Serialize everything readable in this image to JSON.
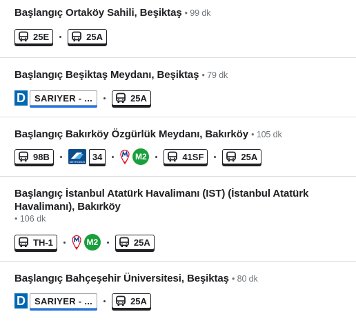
{
  "routes": [
    {
      "prefix": "Başlangıç",
      "place": "Ortaköy Sahili, Beşiktaş",
      "duration": "99 dk",
      "legs": [
        "25E",
        "25A"
      ]
    },
    {
      "prefix": "Başlangıç",
      "place": "Beşiktaş Meydanı, Beşiktaş",
      "duration": "79 dk",
      "ferry_icon": "D",
      "ferry_label": "SARIYER - ...",
      "legs": [
        "25A"
      ]
    },
    {
      "prefix": "Başlangıç",
      "place": "Bakırköy Özgürlük Meydanı, Bakırköy",
      "duration": "105 dk",
      "legs": [
        "98B",
        "34",
        "M2",
        "41SF",
        "25A"
      ],
      "metrobus_text": "METROBÜS"
    },
    {
      "prefix": "Başlangıç",
      "place_line1": "İstanbul Atatürk Havalimanı (IST) (İstanbul Atatürk",
      "place_line2": "Havalimanı), Bakırköy",
      "duration": "106 dk",
      "legs": [
        "TH-1",
        "M2",
        "25A"
      ]
    },
    {
      "prefix": "Başlangıç",
      "place": "Bahçeşehir Üniversitesi, Beşiktaş",
      "duration": "80 dk",
      "ferry_icon": "D",
      "ferry_label": "SARIYER - ...",
      "legs": [
        "25A"
      ]
    }
  ],
  "icons": {
    "bus": "bus-icon",
    "ferry": "ferry-icon",
    "metrobus": "metrobus-icon",
    "metro": "metro-icon"
  },
  "colors": {
    "ferry_blue": "#0068b3",
    "metro_green": "#199f3c",
    "metro_red": "#e30613",
    "ferry_underline": "#1a73e8"
  }
}
